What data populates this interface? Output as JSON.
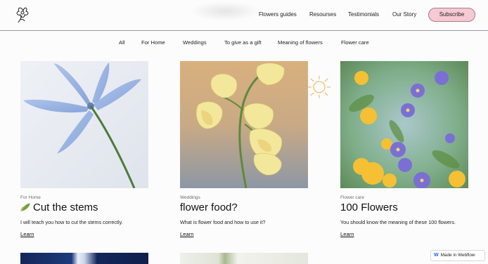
{
  "header": {
    "nav": [
      "Flowers guides",
      "Resourses",
      "Testimonials",
      "Our Story"
    ],
    "subscribe_label": "Subscribe"
  },
  "categories": [
    "All",
    "For Home",
    "Weddings",
    "To give as a gift",
    "Meaning of flowers",
    "Flower care"
  ],
  "cards": [
    {
      "category": "For Home",
      "title": "Cut the stems",
      "title_icon": "leaf-icon",
      "description": "I will teach you how to cut the stems correctly.",
      "link": "Learn"
    },
    {
      "category": "Weddings",
      "title": "flower food?",
      "description": "What is flower food and how to use it?",
      "link": "Learn"
    },
    {
      "category": "Flower care",
      "title": "100 Flowers",
      "description": "You should know the meaning of these 100 flowers.",
      "link": "Learn"
    }
  ],
  "badge": {
    "label": "Made in Webflow",
    "icon": "webflow-logo-icon"
  },
  "colors": {
    "subscribe_bg": "#f6c9d3",
    "divider": "#9a99a3",
    "accent_sun": "#e7b24a"
  }
}
